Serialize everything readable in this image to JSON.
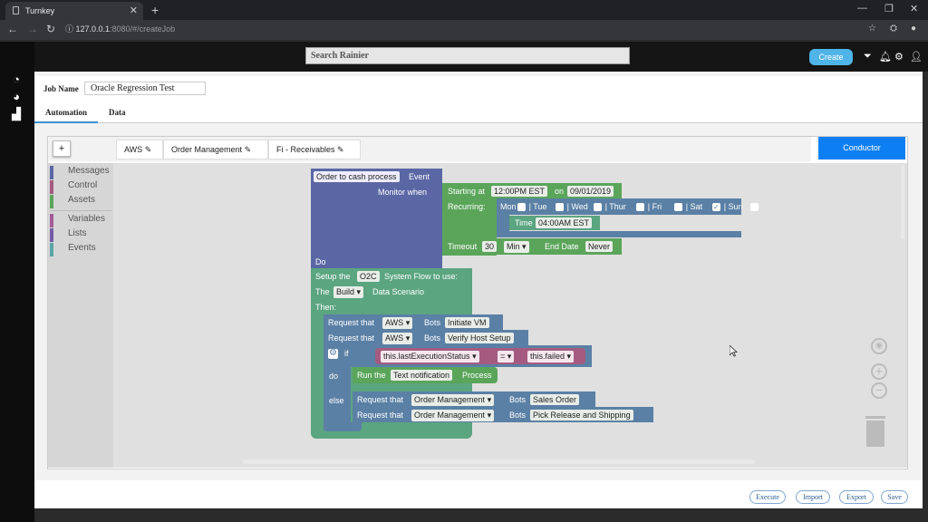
{
  "browser": {
    "tab_title": "Turnkey",
    "url_host": "127.0.0.1",
    "url_rest": ":8080/#/createJob"
  },
  "topbar": {
    "search_placeholder": "Search Rainier",
    "create_label": "Create"
  },
  "job": {
    "name_label": "Job Name",
    "name_value": "Oracle Regression Test"
  },
  "tabs": [
    "Automation",
    "Data"
  ],
  "services": [
    "AWS",
    "Order Management",
    "Fi - Receivables"
  ],
  "plus_label": "+",
  "conductor_label": "Conductor",
  "categories": [
    {
      "label": "Messages",
      "color": "#5b67a5"
    },
    {
      "label": "Control",
      "color": "#a55b80"
    },
    {
      "label": "Assets",
      "color": "#5ba55b"
    },
    {
      "label": "Variables",
      "color": "#a55b99"
    },
    {
      "label": "Lists",
      "color": "#745ba5"
    },
    {
      "label": "Events",
      "color": "#5ba5a5"
    }
  ],
  "blocks": {
    "event_name": "Order to cash process",
    "event_word": "Event",
    "monitor_when": "Monitor when",
    "do_label": "Do",
    "starting_at": "Starting at",
    "start_time": "12:00PM EST",
    "on_label": "on",
    "start_date": "09/01/2019",
    "recurring": "Recurring:",
    "days": [
      {
        "label": "Mon",
        "checked": false
      },
      {
        "label": "| Tue",
        "checked": false
      },
      {
        "label": "| Wed",
        "checked": false
      },
      {
        "label": "| Thur",
        "checked": false
      },
      {
        "label": "| Fri",
        "checked": false
      },
      {
        "label": "| Sat",
        "checked": true
      },
      {
        "label": "| Sun",
        "checked": false
      }
    ],
    "time_label": "Time",
    "time_value": "04:00AM EST",
    "timeout_label": "Timeout",
    "timeout_value": "30",
    "timeout_unit": "Min",
    "end_date_label": "End Date",
    "end_date_value": "Never",
    "setup_prefix": "Setup the",
    "setup_flow": "O2C",
    "setup_suffix": "System Flow to use:",
    "the_label": "The",
    "scenario": "Build",
    "scenario_suffix": "Data Scenario",
    "then_label": "Then:",
    "request_that": "Request that",
    "bots_label": "Bots",
    "req1_service": "AWS",
    "req1_bot": "Initiate VM",
    "req2_service": "AWS",
    "req2_bot": "Verify Host Setup",
    "if_label": "if",
    "cond_left": "this.lastExecutionStatus",
    "cond_op": "=",
    "cond_right": "this.failed",
    "do2_label": "do",
    "run_the": "Run the",
    "run_name": "Text notification",
    "process_label": "Process",
    "else_label": "else",
    "req3_service": "Order Management",
    "req3_bot": "Sales Order",
    "req4_service": "Order Management",
    "req4_bot": "Pick Release and Shipping"
  },
  "bottom_buttons": [
    "Execute",
    "Import",
    "Export",
    "Save"
  ]
}
